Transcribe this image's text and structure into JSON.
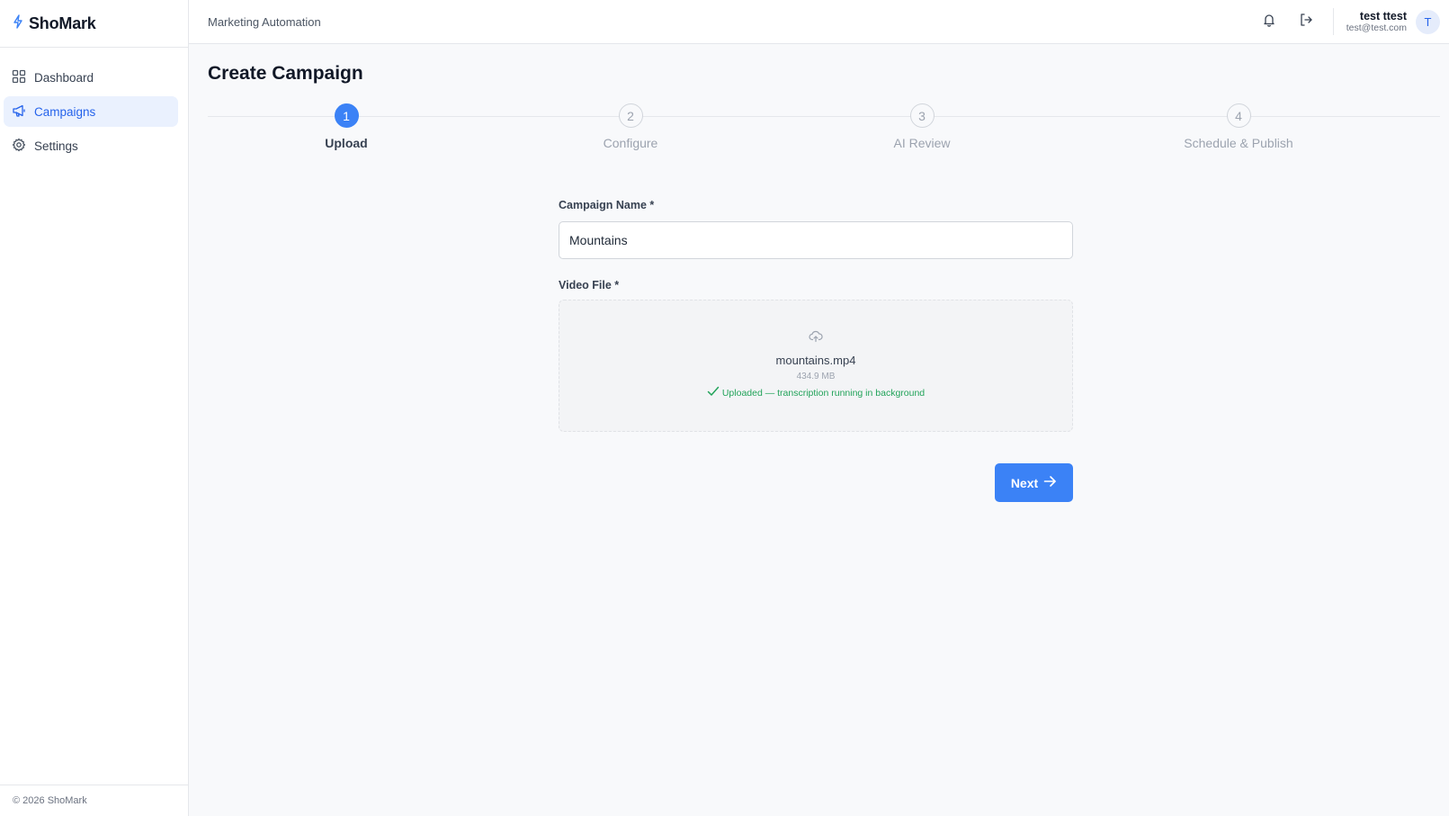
{
  "brand": {
    "name": "ShoMark",
    "icon": "bolt-icon",
    "accent": "#3b82f6"
  },
  "sidebar": {
    "items": [
      {
        "label": "Dashboard",
        "icon": "grid-icon",
        "active": false
      },
      {
        "label": "Campaigns",
        "icon": "megaphone-icon",
        "active": true
      },
      {
        "label": "Settings",
        "icon": "gear-icon",
        "active": false
      }
    ],
    "footer": "© 2026 ShoMark"
  },
  "topbar": {
    "title": "Marketing Automation",
    "icons": [
      "bell-icon",
      "logout-icon"
    ],
    "user": {
      "name": "test ttest",
      "email": "test@test.com",
      "initial": "T"
    }
  },
  "page": {
    "title": "Create Campaign"
  },
  "stepper": {
    "steps": [
      {
        "number": "1",
        "label": "Upload",
        "active": true
      },
      {
        "number": "2",
        "label": "Configure",
        "active": false
      },
      {
        "number": "3",
        "label": "AI Review",
        "active": false
      },
      {
        "number": "4",
        "label": "Schedule & Publish",
        "active": false
      }
    ]
  },
  "form": {
    "campaign_name_label": "Campaign Name *",
    "campaign_name_value": "Mountains",
    "video_label": "Video File *",
    "upload": {
      "icon": "cloud-upload-icon",
      "file_name": "mountains.mp4",
      "file_size": "434.9 MB",
      "status": "Uploaded — transcription running in background",
      "status_color": "#22a35a"
    },
    "next_label": "Next"
  }
}
